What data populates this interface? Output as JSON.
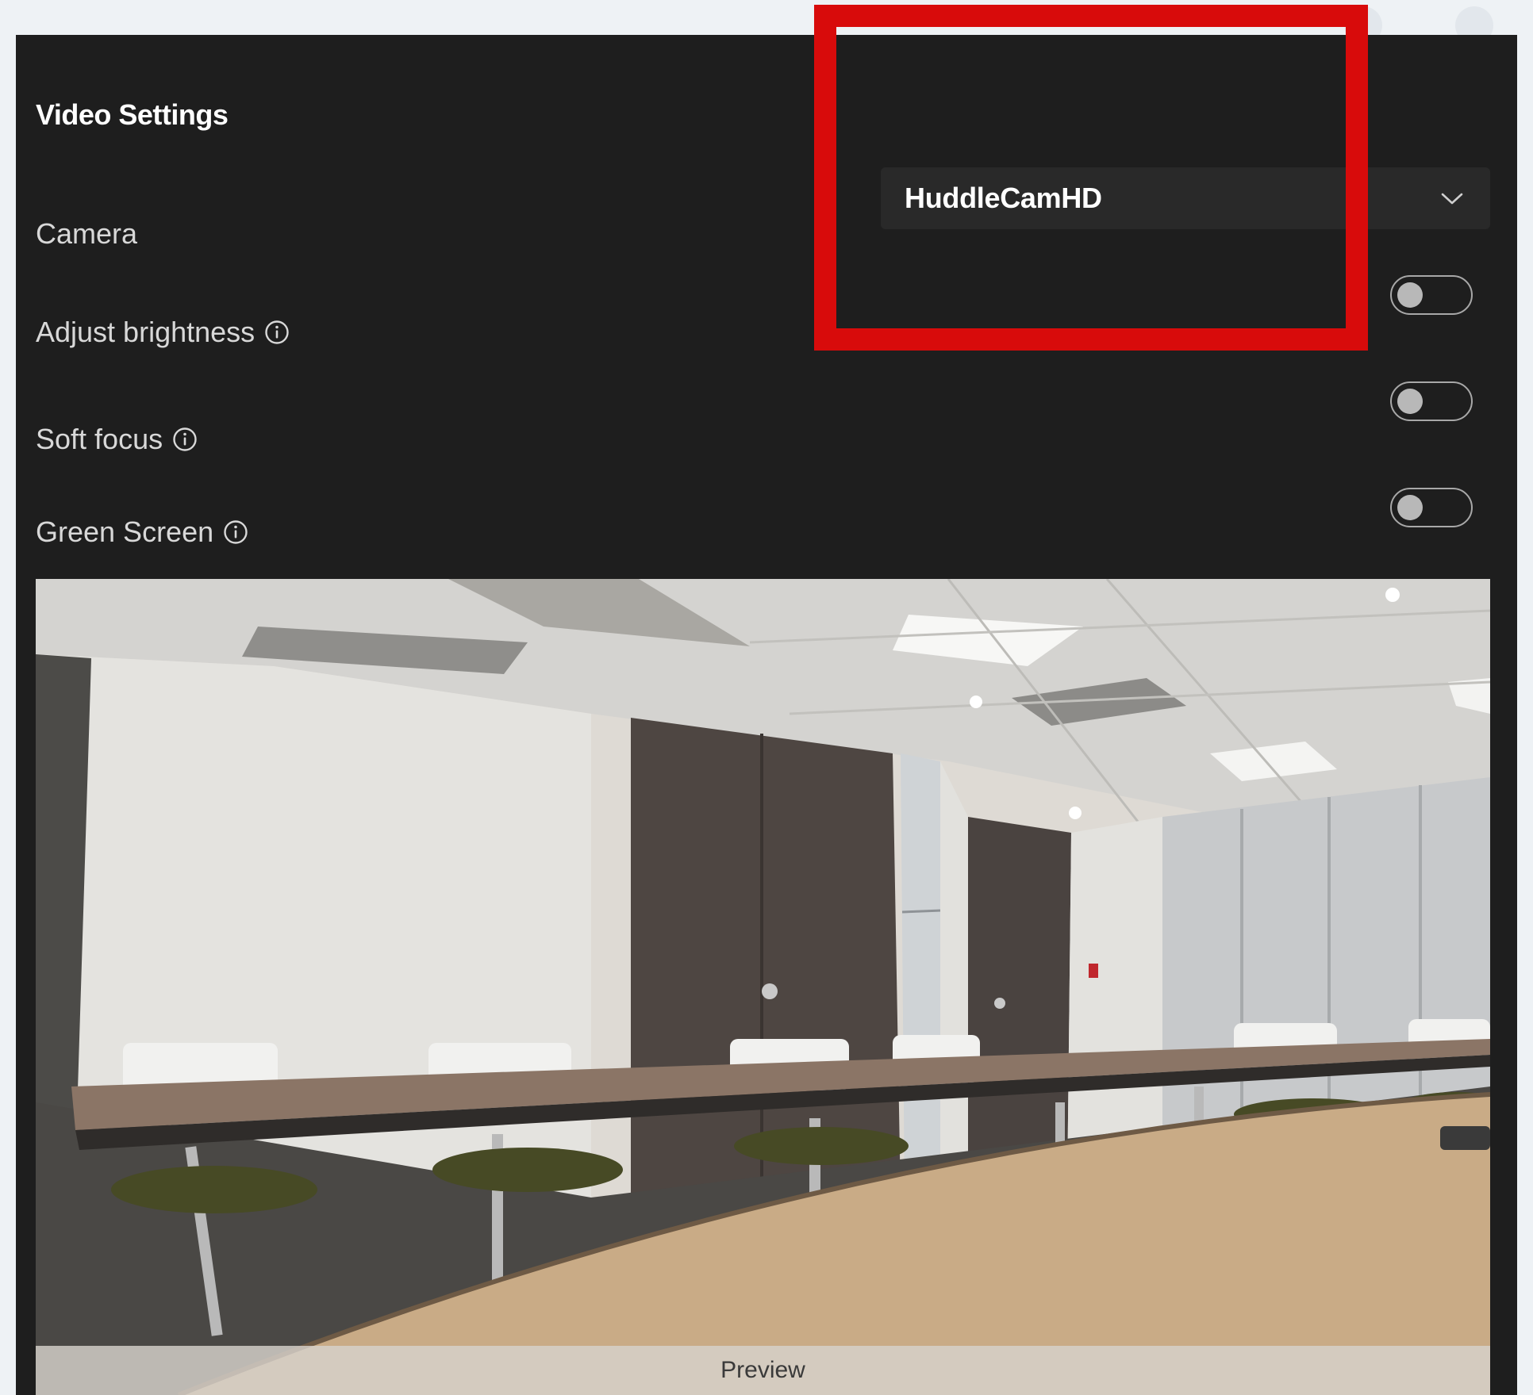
{
  "settings": {
    "title": "Video Settings",
    "camera_label": "Camera",
    "camera_value": "HuddleCamHD",
    "brightness_label": "Adjust brightness",
    "brightness_on": false,
    "soft_focus_label": "Soft focus",
    "soft_focus_on": false,
    "green_screen_label": "Green Screen",
    "green_screen_on": false
  },
  "preview": {
    "label": "Preview"
  },
  "colors": {
    "panel_bg": "#1e1e1e",
    "highlight": "#d80b0b",
    "toggle_off": "#b8b8b8"
  },
  "icons": {
    "info": "info-icon",
    "dropdown": "chevron-down-icon"
  }
}
